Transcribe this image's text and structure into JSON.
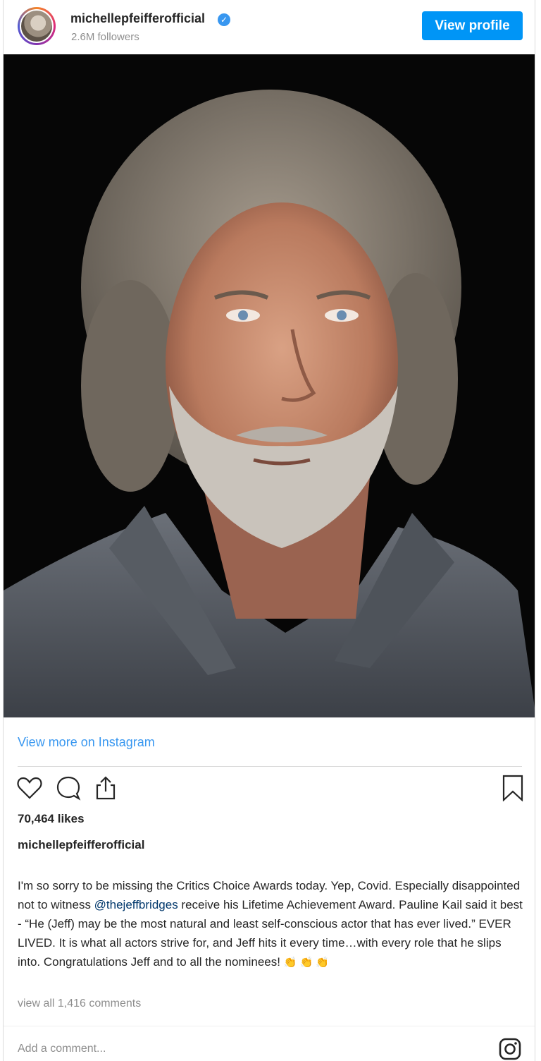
{
  "header": {
    "username": "michellepfeifferofficial",
    "verified_mark": "✓",
    "followers": "2.6M followers",
    "view_profile_label": "View profile"
  },
  "post": {
    "image_subject": "portrait-photo",
    "view_more_label": "View more on Instagram",
    "likes": "70,464 likes",
    "caption_username": "michellepfeifferofficial",
    "caption_part1": "I'm so sorry to be missing the Critics Choice Awards today. Yep, Covid. Especially disappointed not to witness ",
    "caption_mention": "@thejeffbridges",
    "caption_part2": " receive his Lifetime Achievement Award. Pauline Kail said it best - “He (Jeff) may be the most natural and least self-conscious actor that has ever lived.” EVER LIVED. It is what all actors strive for, and Jeff hits it every time…with every role that he slips into. Congratulations Jeff and to all the nominees! ",
    "caption_emoji": "👏 👏 👏",
    "view_comments": "view all 1,416 comments",
    "add_comment_placeholder": "Add a comment..."
  },
  "icons": {
    "like": "heart-icon",
    "comment": "comment-icon",
    "share": "share-icon",
    "save": "bookmark-icon",
    "instagram": "instagram-icon"
  },
  "colors": {
    "accent": "#0095f6",
    "link": "#3897f0",
    "muted": "#8e8e8e"
  }
}
